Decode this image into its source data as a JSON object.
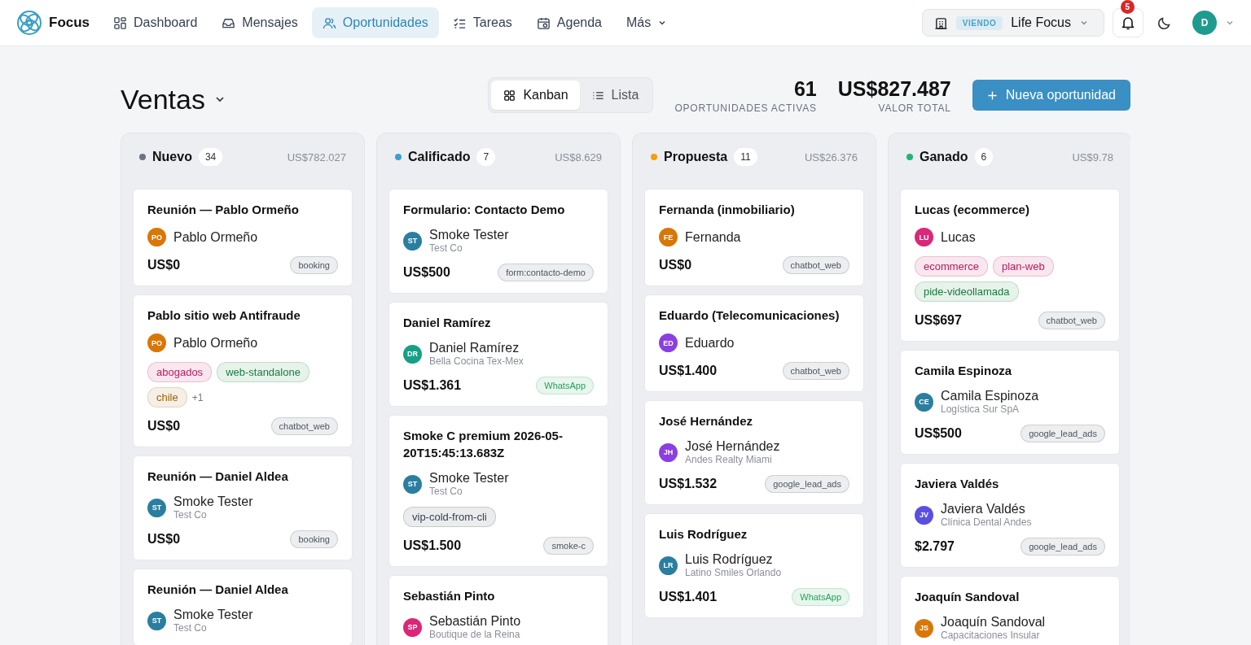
{
  "brand": {
    "name": "Focus"
  },
  "nav": [
    {
      "label": "Dashboard",
      "kind": "grid",
      "selected": false
    },
    {
      "label": "Mensajes",
      "kind": "inbox",
      "selected": false
    },
    {
      "label": "Oportunidades",
      "kind": "users",
      "selected": true
    },
    {
      "label": "Tareas",
      "kind": "checklist",
      "selected": false
    },
    {
      "label": "Agenda",
      "kind": "calendar",
      "selected": false
    },
    {
      "label": "Más",
      "kind": "menu",
      "selected": false
    }
  ],
  "workspace": {
    "badge": "VIENDO",
    "name": "Life Focus"
  },
  "notifications": {
    "count": "5"
  },
  "user": {
    "initial": "D"
  },
  "page": {
    "title": "Ventas",
    "views": [
      {
        "label": "Kanban",
        "kind": "grid",
        "selected": true
      },
      {
        "label": "Lista",
        "kind": "list",
        "selected": false
      }
    ],
    "stats": [
      {
        "value": "61",
        "label": "OPORTUNIDADES ACTIVAS"
      },
      {
        "value": "US$827.487",
        "label": "VALOR TOTAL"
      }
    ],
    "new_button": "Nueva oportunidad"
  },
  "columns": [
    {
      "name": "Nuevo",
      "color": "#6b7280",
      "count": "34",
      "total": "US$782.027",
      "cards": [
        {
          "title": "Reunión — Pablo Ormeño",
          "contact": "Pablo Ormeño",
          "initials": "PO",
          "color": "#d97706",
          "amount": "US$0",
          "source": {
            "label": "booking",
            "color": "#4b5563"
          }
        },
        {
          "title": "Pablo sitio web Antifraude",
          "contact": "Pablo Ormeño",
          "initials": "PO",
          "color": "#d97706",
          "tags": [
            {
              "label": "abogados",
              "color": "#be185d"
            },
            {
              "label": "web-standalone",
              "color": "#15803d"
            },
            {
              "label": "chile",
              "color": "#a16207"
            }
          ],
          "more": "+1",
          "amount": "US$0",
          "source": {
            "label": "chatbot_web",
            "color": "#4b5563"
          }
        },
        {
          "title": "Reunión — Daniel Aldea",
          "contact": "Smoke Tester",
          "company": "Test Co",
          "initials": "ST",
          "color": "#2a7fa0",
          "amount": "US$0",
          "source": {
            "label": "booking",
            "color": "#4b5563"
          }
        },
        {
          "title": "Reunión — Daniel Aldea",
          "contact": "Smoke Tester",
          "company": "Test Co",
          "initials": "ST",
          "color": "#2a7fa0"
        }
      ]
    },
    {
      "name": "Calificado",
      "color": "#3b9fd0",
      "count": "7",
      "total": "US$8.629",
      "cards": [
        {
          "title": "Formulario: Contacto Demo",
          "contact": "Smoke Tester",
          "company": "Test Co",
          "initials": "ST",
          "color": "#2a7fa0",
          "amount": "US$500",
          "source": {
            "label": "form:contacto-demo",
            "color": "#4b5563"
          }
        },
        {
          "title": "Daniel Ramírez",
          "contact": "Daniel Ramírez",
          "company": "Bella Cocina Tex-Mex",
          "initials": "DR",
          "color": "#16a085",
          "amount": "US$1.361",
          "source": {
            "label": "WhatsApp",
            "color": "#22a35a"
          }
        },
        {
          "title": "Smoke C premium 2026-05-20T15:45:13.683Z",
          "contact": "Smoke Tester",
          "company": "Test Co",
          "initials": "ST",
          "color": "#2a7fa0",
          "tags": [
            {
              "label": "vip-cold-from-cli",
              "color": "#374151"
            }
          ],
          "amount": "US$1.500",
          "source": {
            "label": "smoke-c",
            "color": "#4b5563"
          }
        },
        {
          "title": "Sebastián Pinto",
          "contact": "Sebastián Pinto",
          "company": "Boutique de la Reina",
          "initials": "SP",
          "color": "#db2777"
        }
      ]
    },
    {
      "name": "Propuesta",
      "color": "#f59e0b",
      "count": "11",
      "total": "US$26.376",
      "cards": [
        {
          "title": "Fernanda (inmobiliario)",
          "contact": "Fernanda",
          "initials": "FE",
          "color": "#d97706",
          "amount": "US$0",
          "source": {
            "label": "chatbot_web",
            "color": "#4b5563"
          }
        },
        {
          "title": "Eduardo (Telecomunicaciones)",
          "contact": "Eduardo",
          "initials": "ED",
          "color": "#8b3fe0",
          "amount": "US$1.400",
          "source": {
            "label": "chatbot_web",
            "color": "#4b5563"
          }
        },
        {
          "title": "José Hernández",
          "contact": "José Hernández",
          "company": "Andes Realty Miami",
          "initials": "JH",
          "color": "#8b3fe0",
          "amount": "US$1.532",
          "source": {
            "label": "google_lead_ads",
            "color": "#4b5563"
          }
        },
        {
          "title": "Luis Rodríguez",
          "contact": "Luis Rodríguez",
          "company": "Latino Smiles Orlando",
          "initials": "LR",
          "color": "#2a7fa0",
          "amount": "US$1.401",
          "source": {
            "label": "WhatsApp",
            "color": "#22a35a"
          }
        }
      ]
    },
    {
      "name": "Ganado",
      "color": "#22b573",
      "count": "6",
      "total": "US$9.78",
      "cards": [
        {
          "title": "Lucas (ecommerce)",
          "contact": "Lucas",
          "initials": "LU",
          "color": "#db2777",
          "tags": [
            {
              "label": "ecommerce",
              "color": "#be185d"
            },
            {
              "label": "plan-web",
              "color": "#be185d"
            },
            {
              "label": "pide-videollamada",
              "color": "#15803d"
            }
          ],
          "amount": "US$697",
          "source": {
            "label": "chatbot_web",
            "color": "#4b5563"
          }
        },
        {
          "title": "Camila Espinoza",
          "contact": "Camila Espinoza",
          "company": "Logística Sur SpA",
          "initials": "CE",
          "color": "#2a7fa0",
          "amount": "US$500",
          "source": {
            "label": "google_lead_ads",
            "color": "#4b5563"
          }
        },
        {
          "title": "Javiera Valdés",
          "contact": "Javiera Valdés",
          "company": "Clínica Dental Andes",
          "initials": "JV",
          "color": "#5b4fe0",
          "amount": "$2.797",
          "source": {
            "label": "google_lead_ads",
            "color": "#4b5563"
          }
        },
        {
          "title": "Joaquín Sandoval",
          "contact": "Joaquín Sandoval",
          "company": "Capacitaciones Insular",
          "initials": "JS",
          "color": "#d97706"
        }
      ]
    }
  ]
}
